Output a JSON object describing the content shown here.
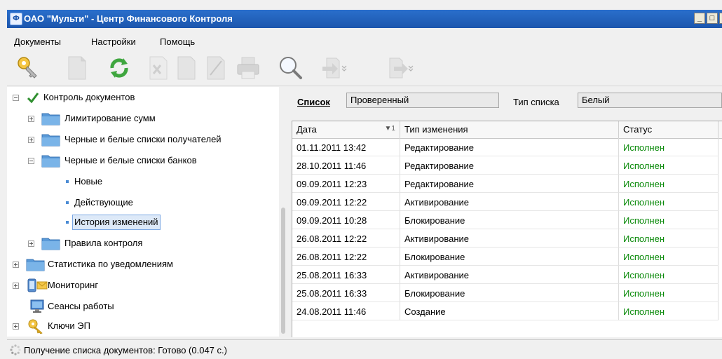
{
  "window": {
    "title": "ОАО \"Мульти\" - Центр Финансового Контроля",
    "icon": "app-icon"
  },
  "menu": [
    "Документы",
    "Настройки",
    "Помощь"
  ],
  "toolbar": {
    "icons": [
      "key-icon",
      "document-icon",
      "refresh-icon",
      "delete-icon",
      "page-icon",
      "sign-icon",
      "print-icon",
      "search-icon",
      "import-icon",
      "export-icon"
    ]
  },
  "tree": {
    "items": [
      {
        "label": "Контроль документов",
        "icon": "checkmark-icon"
      },
      {
        "label": "Лимитирование сумм",
        "icon": "folder-icon"
      },
      {
        "label": "Черные и белые списки получателей",
        "icon": "folder-icon"
      },
      {
        "label": "Черные и белые списки банков",
        "icon": "folder-icon"
      },
      {
        "label": "Новые",
        "icon": "bullet-icon"
      },
      {
        "label": "Действующие",
        "icon": "bullet-icon"
      },
      {
        "label": "История изменений",
        "icon": "bullet-icon",
        "selected": true
      },
      {
        "label": "Правила контроля",
        "icon": "folder-icon"
      },
      {
        "label": "Статистика по уведомлениям",
        "icon": "folder-icon"
      },
      {
        "label": "Мониторинг",
        "icon": "monitor-icon"
      },
      {
        "label": "Сеансы работы",
        "icon": "computer-icon"
      },
      {
        "label": "Ключи ЭП",
        "icon": "key-icon"
      }
    ]
  },
  "filter": {
    "list_label": "Список",
    "list_value": "Проверенный",
    "type_label": "Тип списка",
    "type_value": "Белый"
  },
  "table": {
    "columns": [
      "Дата",
      "Тип изменения",
      "Статус"
    ],
    "sort_indicator": "▼1",
    "rows": [
      [
        "01.11.2011 13:42",
        "Редактирование",
        "Исполнен"
      ],
      [
        "28.10.2011 11:46",
        "Редактирование",
        "Исполнен"
      ],
      [
        "09.09.2011 12:23",
        "Редактирование",
        "Исполнен"
      ],
      [
        "09.09.2011 12:22",
        "Активирование",
        "Исполнен"
      ],
      [
        "09.09.2011 10:28",
        "Блокирование",
        "Исполнен"
      ],
      [
        "26.08.2011 12:22",
        "Активирование",
        "Исполнен"
      ],
      [
        "26.08.2011 12:22",
        "Блокирование",
        "Исполнен"
      ],
      [
        "25.08.2011 16:33",
        "Активирование",
        "Исполнен"
      ],
      [
        "25.08.2011 16:33",
        "Блокирование",
        "Исполнен"
      ],
      [
        "24.08.2011 11:46",
        "Создание",
        "Исполнен"
      ]
    ]
  },
  "status": {
    "text": "Получение списка документов: Готово (0.047 с.)",
    "icon": "spinner-icon"
  },
  "colors": {
    "titlebar": "#1c56ad",
    "status_ok": "#0a8a0a",
    "selection": "#dde9f8"
  }
}
